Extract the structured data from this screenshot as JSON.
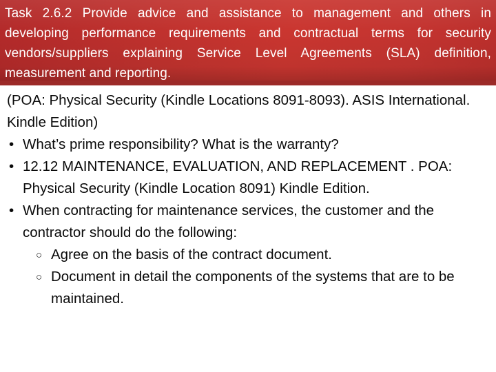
{
  "slide": {
    "header": {
      "text": "Task 2.6.2 Provide advice and assistance to management and others in developing performance requirements and contractual terms for security vendors/suppliers explaining Service Level Agreements (SLA) definition, measurement and reporting.",
      "background_color": "#c0322e",
      "accent_strip_color": "#9c2a28",
      "text_color": "#ffffff"
    },
    "body": {
      "background_color": "#ffffff",
      "text_color": "#000000",
      "citation": "(POA: Physical Security (Kindle Locations 8091-8093). ASIS International. Kindle Edition)",
      "bullet_marker": "•",
      "sub_bullet_marker": "○",
      "bullets": [
        {
          "text": "What’s prime responsibility?  What is the warranty?",
          "sub_bullets": []
        },
        {
          "text": "12.12 MAINTENANCE, EVALUATION, AND REPLACEMENT . POA: Physical Security (Kindle Location 8091) Kindle Edition.",
          "sub_bullets": []
        },
        {
          "text": "When contracting for maintenance services, the customer and the contractor should do the following:",
          "sub_bullets": [
            "Agree on the basis of the contract document.",
            "Document in detail the components of the systems that are to be maintained."
          ]
        }
      ]
    }
  }
}
